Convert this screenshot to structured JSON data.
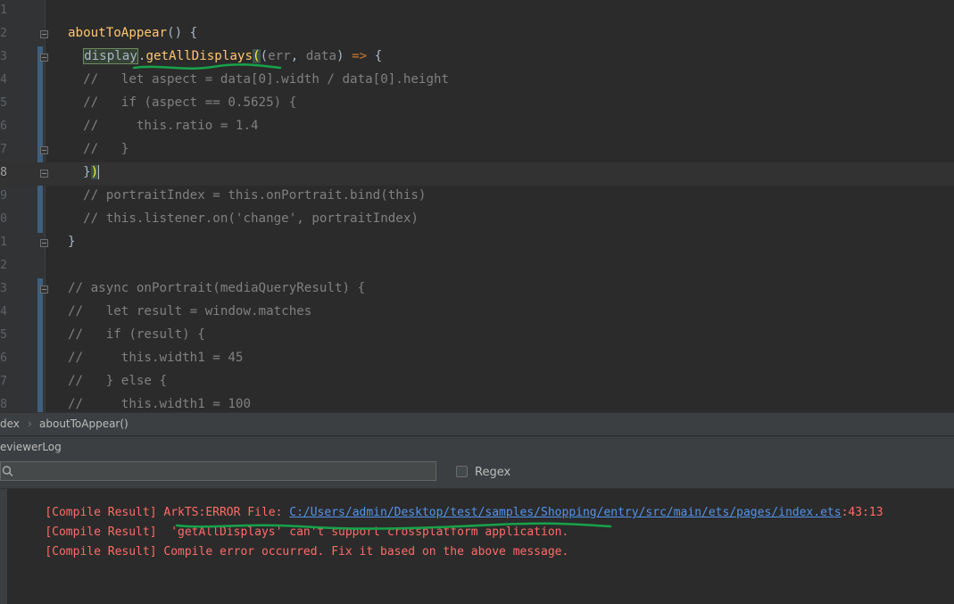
{
  "editor": {
    "lines": [
      {
        "num": "1",
        "html": ""
      },
      {
        "num": "2",
        "html": "<span class=\"kw-fn\">aboutToAppear</span>() {"
      },
      {
        "num": "3",
        "html": "  <span class=\"sel-box\">display</span>.<span class=\"kw-fn\">getAllDisplays</span><span class=\"brace-hl\">(</span>(<span class=\"pm\">err</span>, <span class=\"pm\">data</span>) <span class=\"kw\">=></span> {"
      },
      {
        "num": "4",
        "html": "  <span class=\"cmt\">//   let aspect = data[0].width / data[0].height</span>"
      },
      {
        "num": "5",
        "html": "  <span class=\"cmt\">//   if (aspect == 0.5625) {</span>"
      },
      {
        "num": "6",
        "html": "  <span class=\"cmt\">//     this.ratio = 1.4</span>"
      },
      {
        "num": "7",
        "html": "  <span class=\"cmt\">//   }</span>"
      },
      {
        "num": "8",
        "html": "  }<span class=\"brace-hl\">)</span><span class=\"caret\"></span>"
      },
      {
        "num": "9",
        "html": "  <span class=\"cmt\">// portraitIndex = this.onPortrait.bind(this)</span>"
      },
      {
        "num": "0",
        "html": "  <span class=\"cmt\">// this.listener.on('change', portraitIndex)</span>"
      },
      {
        "num": "1",
        "html": "}"
      },
      {
        "num": "2",
        "html": ""
      },
      {
        "num": "3",
        "html": "<span class=\"cmt\">// async onPortrait(mediaQueryResult) {</span>"
      },
      {
        "num": "4",
        "html": "<span class=\"cmt\">//   let result = window.matches</span>"
      },
      {
        "num": "5",
        "html": "<span class=\"cmt\">//   if (result) {</span>"
      },
      {
        "num": "6",
        "html": "<span class=\"cmt\">//     this.width1 = 45</span>"
      },
      {
        "num": "7",
        "html": "<span class=\"cmt\">//   } else {</span>"
      },
      {
        "num": "8",
        "html": "<span class=\"cmt\">//     this.width1 = 100</span>"
      }
    ]
  },
  "breadcrumb": {
    "file": "dex",
    "separator": "›",
    "method": "aboutToAppear()"
  },
  "log_panel": {
    "title": "eviewerLog",
    "search_value": "",
    "regex_label": "Regex",
    "lines": [
      {
        "prefix": "[Compile Result] ArkTS:ERROR File: ",
        "link": "C:/Users/admin/Desktop/test/samples/Shopping/entry/src/main/ets/pages/index.ets",
        "suffix": ":43:13"
      },
      {
        "prefix": "[Compile Result]  'getAllDisplays' can't support crossplatform application.",
        "link": "",
        "suffix": ""
      },
      {
        "prefix": "[Compile Result] Compile error occurred. Fix it based on the above message.",
        "link": "",
        "suffix": ""
      }
    ]
  },
  "colors": {
    "editor_bg": "#2b2b2b",
    "error_text": "#ff6b68",
    "link": "#5394ec",
    "annotation_green": "#16a34a"
  }
}
